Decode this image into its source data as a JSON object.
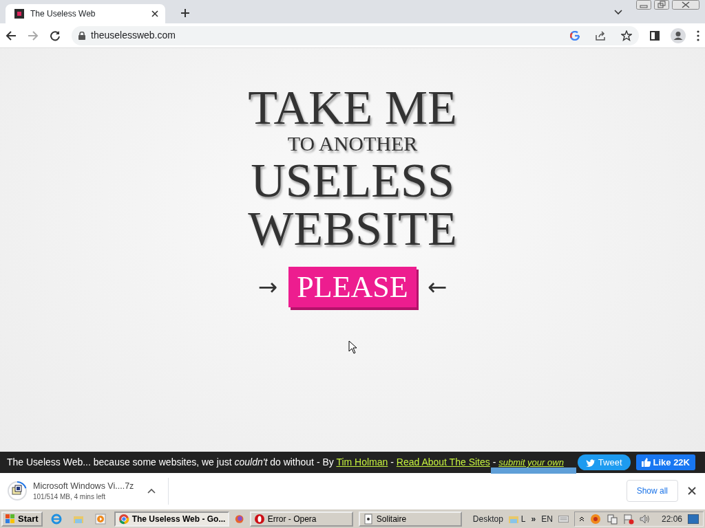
{
  "browser": {
    "tab": {
      "title": "The Useless Web",
      "selected": true
    },
    "address": "theuselessweb.com"
  },
  "page": {
    "heading_lines": [
      {
        "text": "TAKE ME",
        "kind": "large"
      },
      {
        "text": "TO ANOTHER",
        "kind": "small"
      },
      {
        "text": "USELESS",
        "kind": "large"
      },
      {
        "text": "WEBSITE",
        "kind": "large"
      }
    ],
    "left_arrow": "→",
    "button": "PLEASE",
    "right_arrow": "←"
  },
  "footer": {
    "parts": [
      {
        "kind": "text",
        "text": "The Useless Web... because some websites, we just *couldn't* do without - By "
      },
      {
        "kind": "link",
        "text": "Tim Holman"
      },
      {
        "kind": "text",
        "text": " - "
      },
      {
        "kind": "link",
        "text": "Read About The Sites"
      },
      {
        "kind": "text",
        "text": " - "
      },
      {
        "kind": "italic-link",
        "text": "submit your own"
      }
    ],
    "tweet": "Tweet",
    "like": "Like 22K"
  },
  "downloads": {
    "file": "Microsoft Windows Vi....7z",
    "progress": "101/514 MB, 4 mins left",
    "level": 0.2,
    "show_all": "Show all"
  },
  "taskbar": {
    "start": "Start",
    "tasks": [
      {
        "title": "The Useless Web - Go...",
        "selected": true,
        "kind": "chrome"
      },
      {
        "title": "Error - Opera",
        "selected": false,
        "kind": "opera"
      },
      {
        "title": "Solitaire",
        "selected": false,
        "kind": "solitaire"
      }
    ],
    "desktop": "Desktop",
    "toolbar_label": "L",
    "chevron": "»",
    "language": "EN",
    "clock": "22:06"
  }
}
